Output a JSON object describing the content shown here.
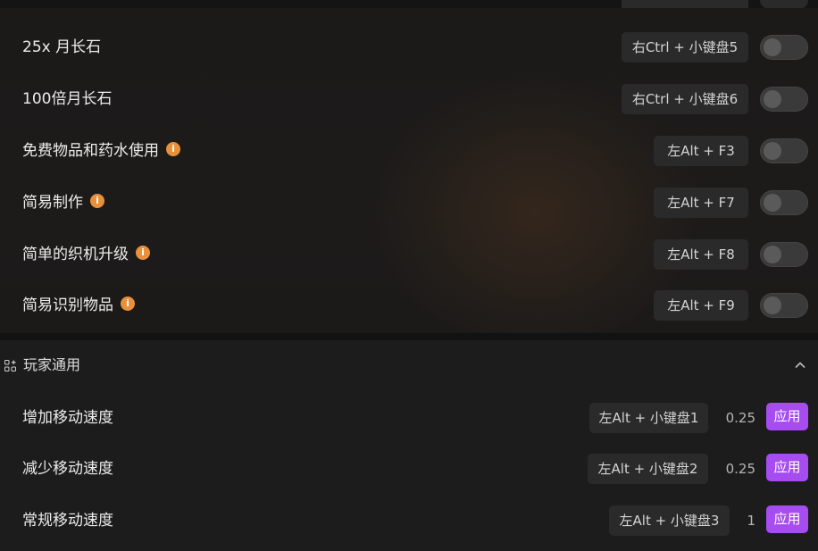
{
  "colors": {
    "accent": "#a64cf0",
    "info_badge": "#e8913a",
    "background": "#1a1a1a"
  },
  "cheat_rows": [
    {
      "label": "25x 月长石",
      "has_info": false,
      "hotkey": "右Ctrl + 小键盘5",
      "enabled": false
    },
    {
      "label": "100倍月长石",
      "has_info": false,
      "hotkey": "右Ctrl + 小键盘6",
      "enabled": false
    },
    {
      "label": "免费物品和药水使用",
      "has_info": true,
      "hotkey": "左Alt + F3",
      "enabled": false
    },
    {
      "label": "简易制作",
      "has_info": true,
      "hotkey": "左Alt + F7",
      "enabled": false
    },
    {
      "label": "简单的织机升级",
      "has_info": true,
      "hotkey": "左Alt + F8",
      "enabled": false
    },
    {
      "label": "简易识别物品",
      "has_info": true,
      "hotkey": "左Alt + F9",
      "enabled": false
    }
  ],
  "info_icon_glyph": "i",
  "section": {
    "title": "玩家通用",
    "icon": "apps-grid-icon",
    "collapse_icon": "chevron-up-icon",
    "rows": [
      {
        "label": "增加移动速度",
        "hotkey": "左Alt + 小键盘1",
        "value": "0.25",
        "apply_label": "应用"
      },
      {
        "label": "减少移动速度",
        "hotkey": "左Alt + 小键盘2",
        "value": "0.25",
        "apply_label": "应用"
      },
      {
        "label": "常规移动速度",
        "hotkey": "左Alt + 小键盘3",
        "value": "1",
        "apply_label": "应用"
      }
    ]
  }
}
